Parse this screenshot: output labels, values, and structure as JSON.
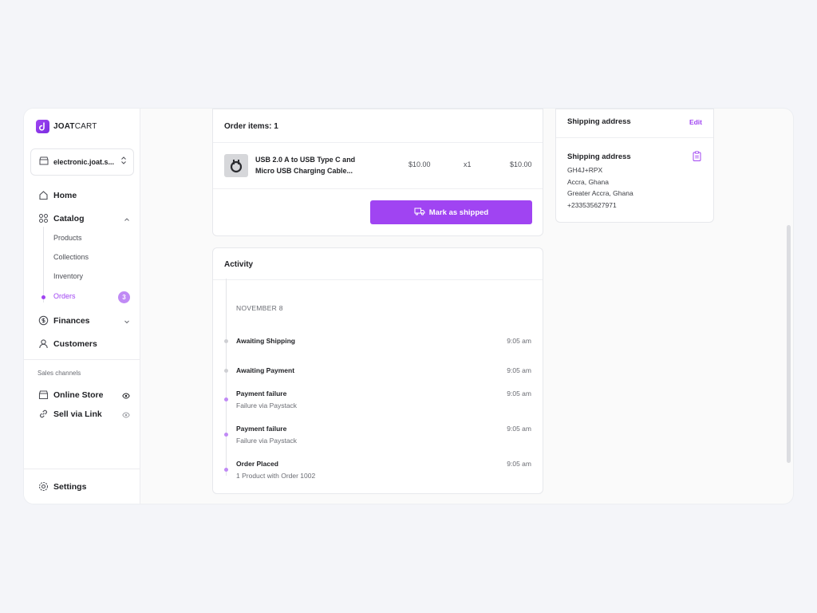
{
  "brand": {
    "name_part1": "JOAT",
    "name_part2": "CART"
  },
  "store_selector": {
    "value": "electronic.joat.s..."
  },
  "sidebar": {
    "home": "Home",
    "catalog": "Catalog",
    "catalog_items": [
      "Products",
      "Collections",
      "Inventory",
      "Orders"
    ],
    "orders_badge": "3",
    "finances": "Finances",
    "customers": "Customers",
    "sales_channels_label": "Sales channels",
    "online_store": "Online Store",
    "sell_via_link": "Sell via Link",
    "settings": "Settings"
  },
  "order_items": {
    "title": "Order items: 1",
    "items": [
      {
        "name": "USB 2.0 A to USB Type C and Micro USB Charging Cable...",
        "unit_price": "$10.00",
        "quantity": "x1",
        "total": "$10.00"
      }
    ],
    "ship_button": "Mark as shipped"
  },
  "activity": {
    "title": "Activity",
    "date": "NOVEMBER 8",
    "events": [
      {
        "title": "Awaiting Shipping",
        "subtitle": "",
        "time": "9:05 am"
      },
      {
        "title": "Awaiting Payment",
        "subtitle": "",
        "time": "9:05 am"
      },
      {
        "title": "Payment failure",
        "subtitle": "Failure via Paystack",
        "time": "9:05 am"
      },
      {
        "title": "Payment failure",
        "subtitle": "Failure via Paystack",
        "time": "9:05 am"
      },
      {
        "title": "Order Placed",
        "subtitle": "1 Product with Order 1002",
        "time": "9:05 am"
      }
    ]
  },
  "shipping": {
    "header_title": "Shipping address",
    "edit_label": "Edit",
    "section_title": "Shipping address",
    "lines": [
      "GH4J+RPX",
      "Accra, Ghana",
      "Greater Accra, Ghana",
      "+233535627971"
    ]
  },
  "colors": {
    "accent": "#a044f2",
    "accent_light": "#c08af5",
    "muted_dot": "#cfd0d4"
  }
}
